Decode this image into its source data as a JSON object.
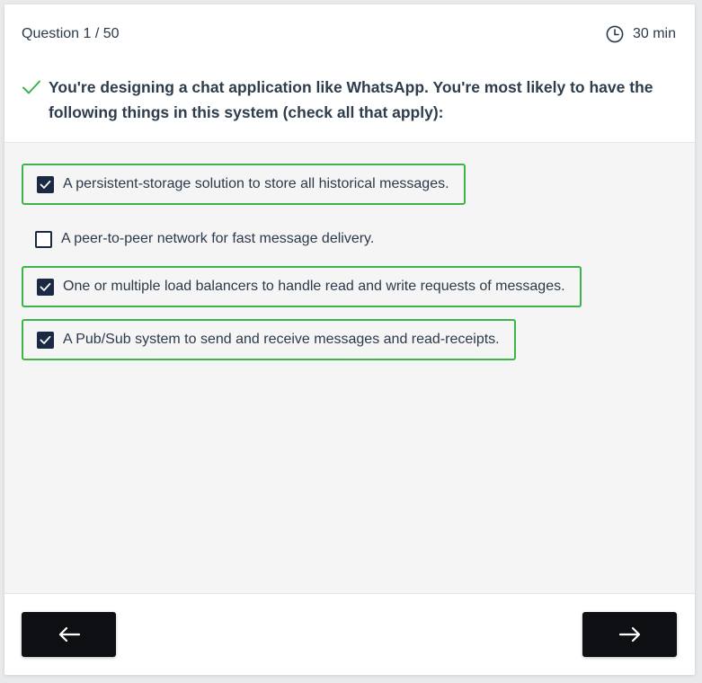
{
  "header": {
    "question_counter": "Question 1 / 50",
    "timer": "30 min",
    "question_text": "You're designing a chat application like WhatsApp. You're most likely to have the following things in this system (check all that apply):"
  },
  "options": [
    {
      "label": "A persistent-storage solution to store all historical messages.",
      "checked": true
    },
    {
      "label": "A peer-to-peer network for fast message delivery.",
      "checked": false
    },
    {
      "label": "One or multiple load balancers to handle read and write requests of messages.",
      "checked": true
    },
    {
      "label": "A Pub/Sub system to send and receive messages and read-receipts.",
      "checked": true
    }
  ],
  "navigation": {
    "prev_icon": "arrow-left-icon",
    "next_icon": "arrow-right-icon"
  },
  "colors": {
    "selected_border": "#3db44a",
    "checkbox_fill": "#1a2a44",
    "nav_button": "#0d0f12",
    "correct_check": "#3db44a"
  }
}
